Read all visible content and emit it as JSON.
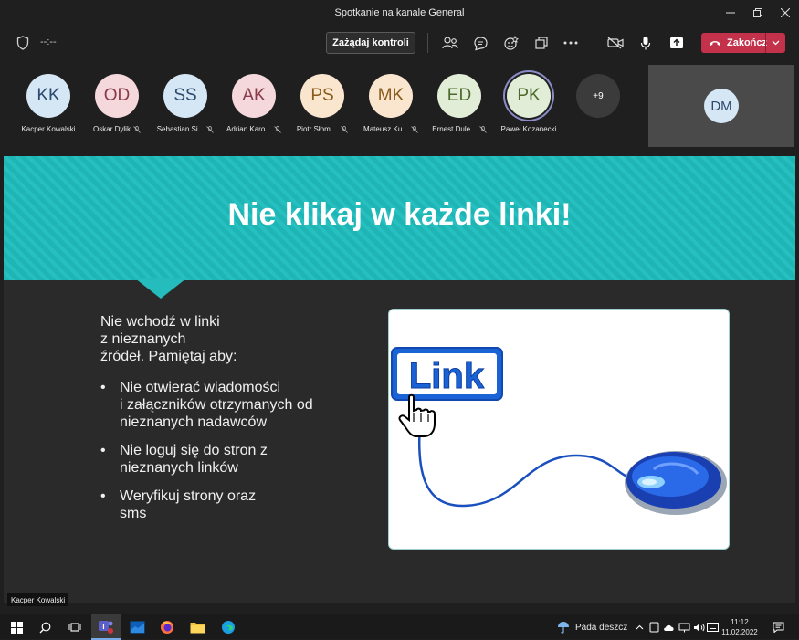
{
  "window": {
    "title": "Spotkanie na kanale General"
  },
  "toolbar": {
    "timer": "--:--",
    "request_control_label": "Zażądaj kontroli",
    "end_label": "Zakończ"
  },
  "participants": [
    {
      "initials": "KK",
      "name": "Kacper Kowalski",
      "muted": false,
      "bg": "#d5e6f5",
      "fg": "#2c4a6e"
    },
    {
      "initials": "OD",
      "name": "Oskar Dylik",
      "muted": true,
      "bg": "#f4d8dc",
      "fg": "#8a3a4a"
    },
    {
      "initials": "SS",
      "name": "Sebastian Si...",
      "muted": true,
      "bg": "#d5e6f5",
      "fg": "#2c4a6e"
    },
    {
      "initials": "AK",
      "name": "Adrian Karo...",
      "muted": true,
      "bg": "#f4d8dc",
      "fg": "#8a3a4a"
    },
    {
      "initials": "PS",
      "name": "Piotr Słomi...",
      "muted": true,
      "bg": "#fae6cf",
      "fg": "#8a5a1a"
    },
    {
      "initials": "MK",
      "name": "Mateusz Ku...",
      "muted": true,
      "bg": "#fae6cf",
      "fg": "#8a5a1a"
    },
    {
      "initials": "ED",
      "name": "Ernest Dule...",
      "muted": true,
      "bg": "#e2edd8",
      "fg": "#4a6a2a"
    },
    {
      "initials": "PK",
      "name": "Paweł Kozanecki",
      "muted": false,
      "bg": "#e2edd8",
      "fg": "#4a6a2a",
      "speaking": true
    }
  ],
  "more_count": "+9",
  "self_tile": {
    "initials": "DM"
  },
  "slide": {
    "title": "Nie klikaj w każde linki!",
    "intro": "Nie wchodź w linki\nz nieznanych\nźródeł. Pamiętaj aby:",
    "bullets": [
      "Nie otwierać wiadomości\ni załączników otrzymanych od\nnieznanych nadawców",
      "Nie loguj się do stron z\nnieznanych linków",
      "Weryfikuj strony oraz\nsms"
    ],
    "image_link_text": "Link"
  },
  "presenter_label": "Kacper Kowalski",
  "taskbar": {
    "weather_text": "Pada deszcz",
    "time": "11:12",
    "date": "11.02.2022"
  },
  "colors": {
    "end_red": "#c4314b",
    "teal": "#1fb5b5",
    "link_blue": "#1a63d6"
  }
}
